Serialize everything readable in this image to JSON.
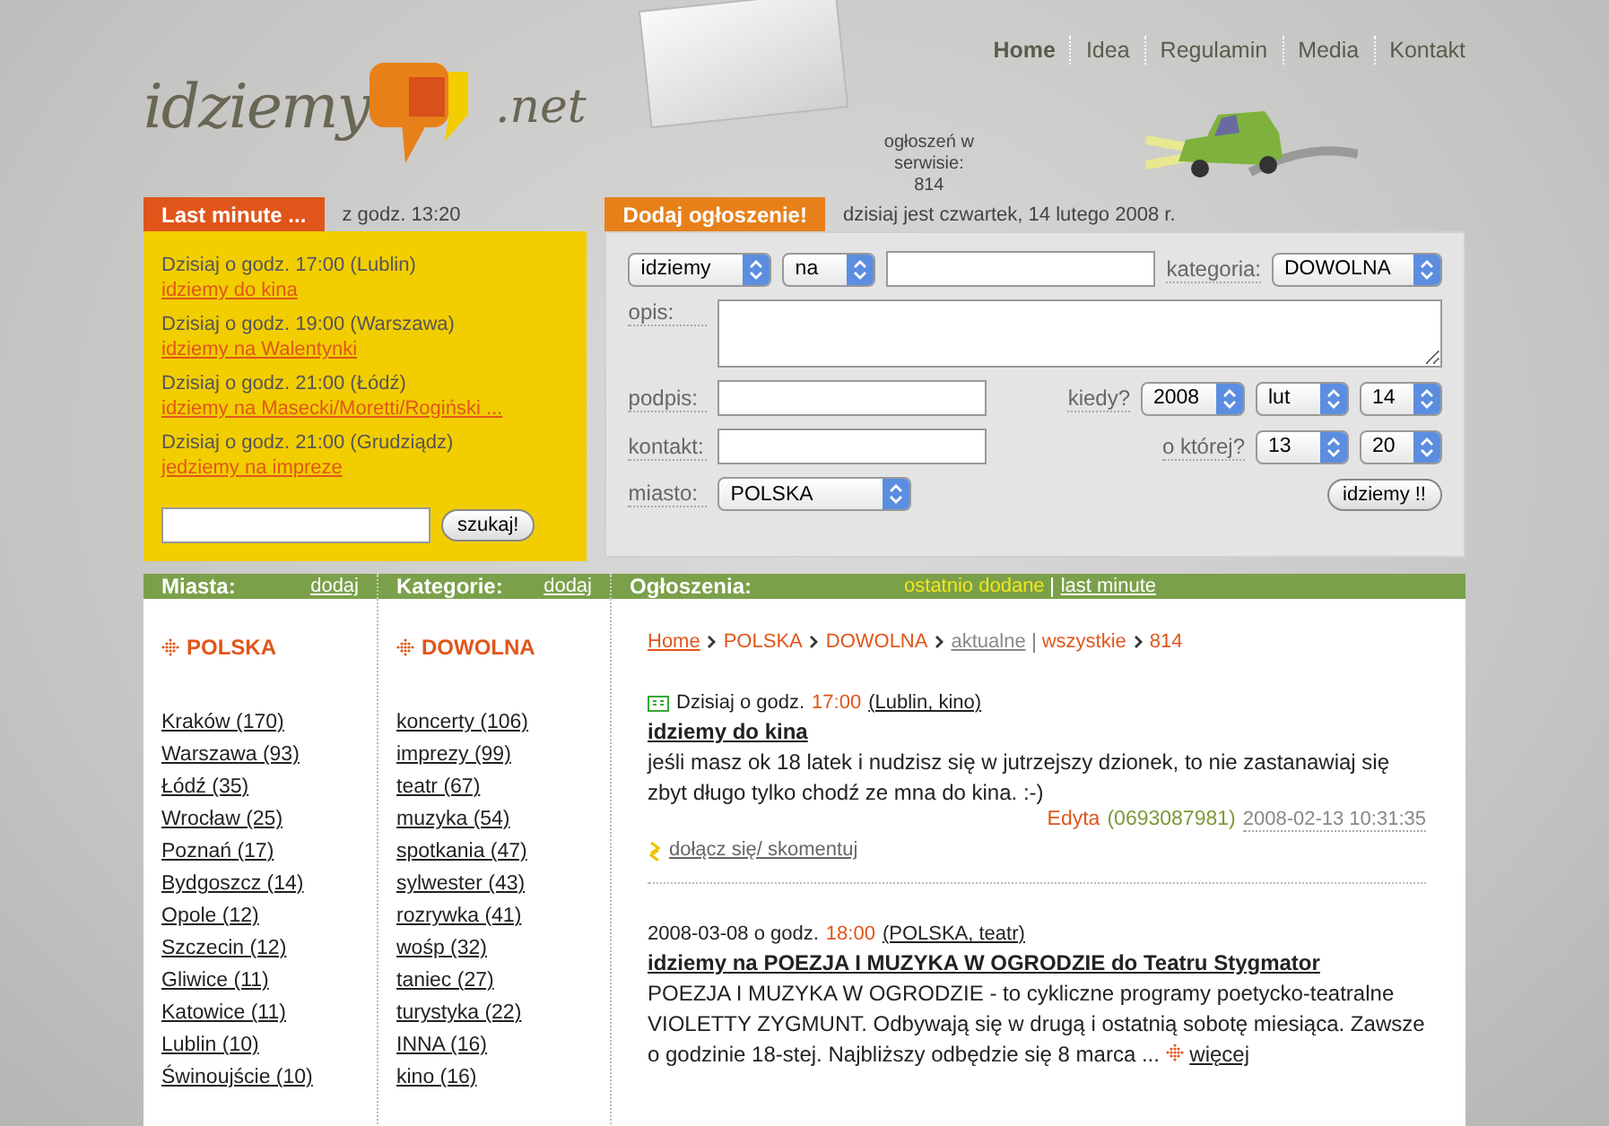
{
  "logo": {
    "text": "idziemy",
    "suffix": ".net"
  },
  "nav": [
    {
      "label": "Home",
      "selected": true
    },
    {
      "label": "Idea",
      "selected": false
    },
    {
      "label": "Regulamin",
      "selected": false
    },
    {
      "label": "Media",
      "selected": false
    },
    {
      "label": "Kontakt",
      "selected": false
    }
  ],
  "counter": {
    "label": "ogłoszeń w serwisie:",
    "value": "814"
  },
  "last_minute": {
    "title": "Last minute ...",
    "since": "z godz. 13:20",
    "items": [
      {
        "when": "Dzisiaj o godz. 17:00 (Lublin)",
        "link": "idziemy do kina"
      },
      {
        "when": "Dzisiaj o godz. 19:00 (Warszawa)",
        "link": "idziemy na Walentynki"
      },
      {
        "when": "Dzisiaj o godz. 21:00 (Łódź)",
        "link": "idziemy na Masecki/Moretti/Rogiński ..."
      },
      {
        "when": "Dzisiaj o godz. 21:00 (Grudziądz)",
        "link": "jedziemy na impreze"
      }
    ],
    "search_button": "szukaj!"
  },
  "add_form": {
    "title": "Dodaj ogłoszenie!",
    "date": "dzisiaj jest czwartek, 14 lutego 2008 r.",
    "verb": "idziemy",
    "prep": "na",
    "category_label": "kategoria:",
    "category": "DOWOLNA",
    "description_label": "opis:",
    "signature_label": "podpis:",
    "when_label": "kiedy?",
    "year": "2008",
    "month": "lut",
    "day": "14",
    "contact_label": "kontakt:",
    "time_label": "o której?",
    "hour": "13",
    "minute": "20",
    "city_label": "miasto:",
    "city": "POLSKA",
    "submit": "idziemy !!"
  },
  "cities": {
    "header": "Miasta:",
    "add": "dodaj",
    "current": "POLSKA",
    "items": [
      "Kraków (170)",
      "Warszawa (93)",
      "Łódź (35)",
      "Wrocław (25)",
      "Poznań (17)",
      "Bydgoszcz (14)",
      "Opole (12)",
      "Szczecin (12)",
      "Gliwice (11)",
      "Katowice (11)",
      "Lublin (10)",
      "Świnoujście (10)"
    ]
  },
  "categories": {
    "header": "Kategorie:",
    "add": "dodaj",
    "current": "DOWOLNA",
    "items": [
      "koncerty (106)",
      "imprezy (99)",
      "teatr (67)",
      "muzyka (54)",
      "spotkania (47)",
      "sylwester (43)",
      "rozrywka (41)",
      "wośp (32)",
      "taniec (27)",
      "turystyka (22)",
      "INNA (16)",
      "kino (16)"
    ]
  },
  "listings": {
    "header": "Ogłoszenia:",
    "filters": [
      {
        "label": "ostatnio dodane",
        "selected": true
      },
      {
        "label": "last minute",
        "selected": false
      }
    ],
    "breadcrumb": [
      {
        "label": "Home",
        "kind": "link"
      },
      {
        "label": "POLSKA",
        "kind": "text"
      },
      {
        "label": "DOWOLNA",
        "kind": "text"
      }
    ],
    "views": [
      {
        "label": "aktualne",
        "selected": false
      },
      {
        "label": "wszystkie",
        "selected": true
      }
    ],
    "count": "814",
    "ads": [
      {
        "flagged": true,
        "date": "Dzisiaj o godz.",
        "time": "17:00",
        "tags": "(Lublin, kino)",
        "title": "idziemy do kina",
        "body": "jeśli masz ok 18 latek i nudzisz się w jutrzejszy dzionek, to nie zastanawiaj się zbyt długo tylko chodź ze mna do kina. :-)",
        "author": "Edyta",
        "phone": "(0693087981)",
        "posted": "2008-02-13 10:31:35",
        "action": "dołącz się/ skomentuj"
      },
      {
        "flagged": false,
        "date": "2008-03-08 o godz.",
        "time": "18:00",
        "tags": "(POLSKA, teatr)",
        "title": "idziemy na POEZJA I MUZYKA W OGRODZIE do Teatru Stygmator",
        "body": "POEZJA I MUZYKA W OGRODZIE - to cykliczne programy poetycko-teatralne VIOLETTY ZYGMUNT. Odbywają się w drugą i ostatnią sobotę miesiąca. Zawsze o godzinie 18-stej. Najbliższy odbędzie się 8 marca ...",
        "more": "więcej"
      }
    ]
  }
}
